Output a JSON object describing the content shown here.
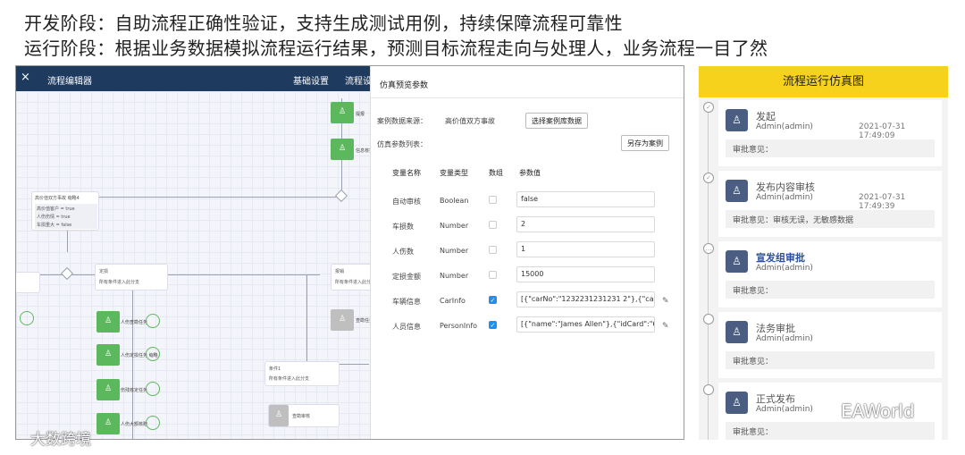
{
  "headings": {
    "line1": "开发阶段：自助流程正确性验证，支持生成测试用例，持续保障流程可靠性",
    "line2": "运行阶段：根据业务数据模拟流程运行结果，预测目标流程走向与处理人，业务流程一目了然"
  },
  "editor": {
    "close_icon": "×",
    "title": "流程编辑器",
    "menu": [
      "基础设置",
      "流程设"
    ],
    "nodes": {
      "top1": "提报",
      "top2": "信息核实",
      "branch_title": "高价值双方事故 缩略4",
      "branch_rows": [
        "高价值客户 = true",
        "人伤伤情 = true",
        "车损重大 = false"
      ],
      "left_card_title": "定损",
      "left_card_sub": "所有条件进入此分支",
      "right_card_title": "报销",
      "right_card_sub": "所有条件进入此分支",
      "mid_card_title": "条件1",
      "mid_card_sub": "所有条件进入此分支",
      "g1": "人伤查勘任务",
      "g2": "人伤定损任务 缩略",
      "g3": "伤残核定任务",
      "g4": "人伤大额核赔",
      "grey1": "查勘任务",
      "grey2": "查勘审核"
    }
  },
  "preview": {
    "title": "仿真预览参数",
    "source_label": "案例数据来源：",
    "source_value": "高价值双方事故",
    "select_case_button": "选择案例库数据",
    "params_label": "仿真参数列表：",
    "save_as_case_button": "另存为案例",
    "columns": [
      "变量名称",
      "变量类型",
      "数组",
      "参数值"
    ],
    "rows": [
      {
        "name": "自动审核",
        "type": "Boolean",
        "array": false,
        "value": "false",
        "editable": false
      },
      {
        "name": "车损数",
        "type": "Number",
        "array": false,
        "value": "2",
        "editable": false
      },
      {
        "name": "人伤数",
        "type": "Number",
        "array": false,
        "value": "1",
        "editable": false
      },
      {
        "name": "定损金额",
        "type": "Number",
        "array": false,
        "value": "15000",
        "editable": false
      },
      {
        "name": "车辆信息",
        "type": "CarInfo",
        "array": true,
        "value": "[{\"carNo\":\"1232231231231 2\"},{\"carBrand\"...",
        "editable": true
      },
      {
        "name": "人员信息",
        "type": "PersonInfo",
        "array": true,
        "value": "[{\"name\":\"James Allen\"},{\"idCard\":\"60232...",
        "editable": true
      }
    ]
  },
  "simulation": {
    "title": "流程运行仿真图",
    "comment_label": "审批意见：",
    "steps": [
      {
        "name": "发起",
        "user": "Admin(admin)",
        "time": "2021-07-31 17:49:09",
        "comment": "",
        "state": "done"
      },
      {
        "name": "发布内容审核",
        "user": "Admin(admin)",
        "time": "2021-07-31 17:49:39",
        "comment": "审核无误，无敏感数据",
        "state": "done"
      },
      {
        "name": "宣发组审批",
        "user": "Admin(admin)",
        "time": "",
        "comment": "",
        "state": "current"
      },
      {
        "name": "法务审批",
        "user": "Admin(admin)",
        "time": "",
        "comment": "",
        "state": "pending"
      },
      {
        "name": "正式发布",
        "user": "Admin(admin)",
        "time": "",
        "comment": "",
        "state": "pending"
      }
    ]
  },
  "watermarks": {
    "left": "大数跨境",
    "right": "EAWorld"
  }
}
